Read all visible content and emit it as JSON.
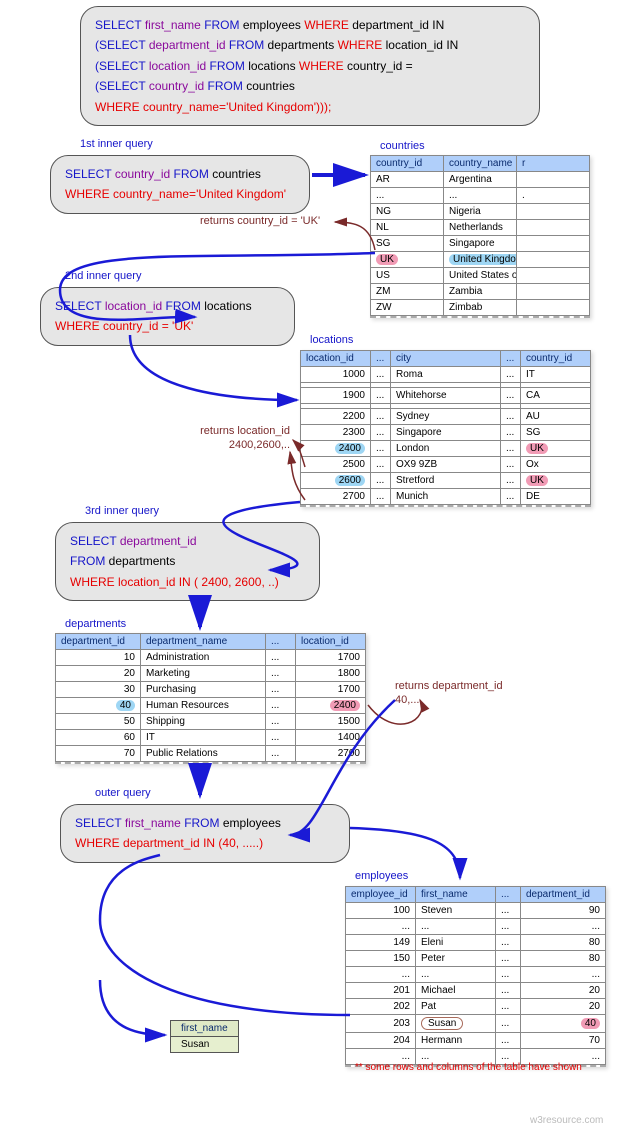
{
  "top_sql": {
    "line1": {
      "p1": "SELECT",
      "p2": "first_name",
      "p3": "FROM",
      "p4": "employees",
      "p5": "WHERE",
      "p6": "department_id IN"
    },
    "line2": {
      "p1": "(SELECT",
      "p2": "department_id",
      "p3": "FROM",
      "p4": "departments",
      "p5": "WHERE",
      "p6": "location_id IN"
    },
    "line3": {
      "p1": "(SELECT",
      "p2": "location_id",
      "p3": "FROM",
      "p4": "locations",
      "p5": "WHERE",
      "p6": "country_id ="
    },
    "line4": {
      "p1": "(SELECT",
      "p2": "country_id",
      "p3": "FROM",
      "p4": "countries"
    },
    "line5": {
      "p1": "WHERE",
      "p2": "country_name='United Kingdom')));"
    }
  },
  "q1": {
    "label": "1st inner query",
    "sql": {
      "a": "SELECT",
      "b": "country_id",
      "c": "FROM",
      "d": "countries",
      "e": "WHERE",
      "f": "country_name='United Kingdom'"
    },
    "returns": "returns country_id = 'UK'"
  },
  "q2": {
    "label": "2nd inner query",
    "sql": {
      "a": "SELECT",
      "b": "location_id",
      "c": "FROM",
      "d": "locations",
      "e": "WHERE",
      "f": "country_id = 'UK'"
    },
    "returns_l1": "returns location_id",
    "returns_l2": "2400,2600,.."
  },
  "q3": {
    "label": "3rd inner query",
    "sql": {
      "a": "SELECT",
      "b": "department_id",
      "c": "FROM",
      "d": "departments",
      "e": "WHERE",
      "f": "location_id IN ( 2400, 2600, ..)"
    },
    "returns_l1": "returns department_id",
    "returns_l2": "40,...."
  },
  "q4": {
    "label": "outer query",
    "sql": {
      "a": "SELECT",
      "b": "first_name",
      "c": "FROM",
      "d": "employees",
      "e": "WHERE",
      "f": "department_id IN (40, .....)"
    }
  },
  "tables": {
    "countries": {
      "title": "countries",
      "headers": [
        "country_id",
        "country_name",
        "r"
      ],
      "rows": [
        [
          "AR",
          "Argentina",
          ""
        ],
        [
          "...",
          "...",
          "."
        ],
        [
          "NG",
          "Nigeria",
          ""
        ],
        [
          "NL",
          "Netherlands",
          ""
        ],
        [
          "SG",
          "Singapore",
          ""
        ],
        [
          "UK",
          "United Kingdom",
          ""
        ],
        [
          "US",
          "United States of America",
          ""
        ],
        [
          "ZM",
          "Zambia",
          ""
        ],
        [
          "ZW",
          "Zimbab",
          ""
        ]
      ],
      "hl_row": 5
    },
    "locations": {
      "title": "locations",
      "headers": [
        "location_id",
        "...",
        "city",
        "...",
        "country_id"
      ],
      "rows": [
        [
          "1000",
          "...",
          "Roma",
          "...",
          "IT"
        ],
        [
          "",
          "",
          "",
          "",
          ""
        ],
        [
          "1900",
          "...",
          "Whitehorse",
          "...",
          "CA"
        ],
        [
          "",
          "",
          "",
          "",
          ""
        ],
        [
          "2200",
          "...",
          "Sydney",
          "...",
          "AU"
        ],
        [
          "2300",
          "...",
          "Singapore",
          "...",
          "SG"
        ],
        [
          "2400",
          "...",
          "London",
          "...",
          "UK"
        ],
        [
          "2500",
          "...",
          "OX9 9ZB",
          "...",
          "Ox"
        ],
        [
          "2600",
          "...",
          "Stretford",
          "...",
          "UK"
        ],
        [
          "2700",
          "...",
          "Munich",
          "...",
          "DE"
        ]
      ],
      "hl_loc": [
        6,
        8
      ],
      "hl_uk": [
        6,
        8
      ]
    },
    "departments": {
      "title": "departments",
      "headers": [
        "department_id",
        "department_name",
        "...",
        "location_id"
      ],
      "rows": [
        [
          "10",
          "Administration",
          "...",
          "1700"
        ],
        [
          "20",
          "Marketing",
          "...",
          "1800"
        ],
        [
          "30",
          "Purchasing",
          "...",
          "1700"
        ],
        [
          "40",
          "Human Resources",
          "...",
          "2400"
        ],
        [
          "50",
          "Shipping",
          "...",
          "1500"
        ],
        [
          "60",
          "IT",
          "...",
          "1400"
        ],
        [
          "70",
          "Public Relations",
          "...",
          "2700"
        ]
      ],
      "hl_row": 3
    },
    "employees": {
      "title": "employees",
      "headers": [
        "employee_id",
        "first_name",
        "...",
        "department_id"
      ],
      "rows": [
        [
          "100",
          "Steven",
          "...",
          "90"
        ],
        [
          "...",
          "...",
          "...",
          "..."
        ],
        [
          "149",
          "Eleni",
          "...",
          "80"
        ],
        [
          "150",
          "Peter",
          "...",
          "80"
        ],
        [
          "...",
          "...",
          "...",
          "..."
        ],
        [
          "201",
          "Michael",
          "...",
          "20"
        ],
        [
          "202",
          "Pat",
          "...",
          "20"
        ],
        [
          "203",
          "Susan",
          "...",
          "40"
        ],
        [
          "204",
          "Hermann",
          "...",
          "70"
        ],
        [
          "...",
          "...",
          "...",
          "..."
        ]
      ],
      "hl_row": 7,
      "note": "** some rows and columns of the table have shown"
    }
  },
  "result": {
    "header": "first_name",
    "row": "Susan"
  },
  "watermark": "w3resource.com"
}
